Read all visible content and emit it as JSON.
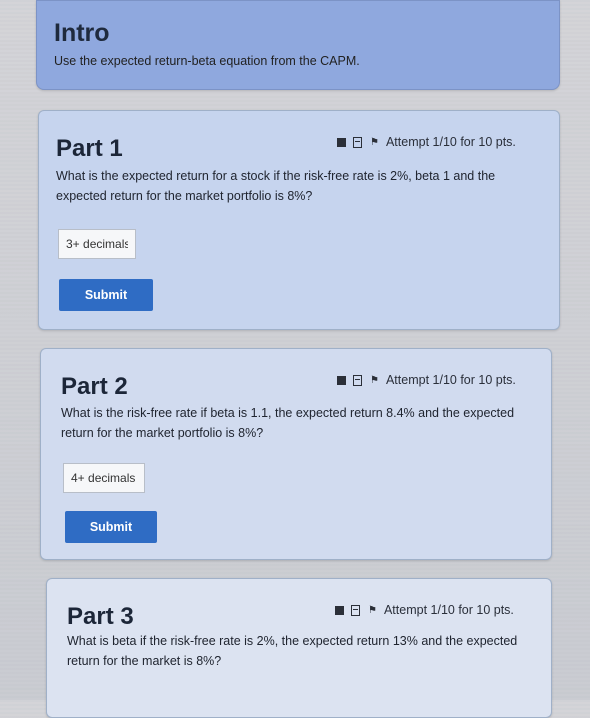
{
  "intro": {
    "title": "Intro",
    "description": "Use the expected return-beta equation from the CAPM."
  },
  "parts": [
    {
      "title": "Part 1",
      "attempt": "Attempt 1/10 for 10 pts.",
      "question": "What is the expected return for a stock if the risk-free rate is 2%, beta 1 and the expected return for the market portfolio is 8%?",
      "placeholder": "3+ decimals",
      "submit_label": "Submit"
    },
    {
      "title": "Part 2",
      "attempt": "Attempt 1/10 for 10 pts.",
      "question": "What is the risk-free rate if beta is 1.1, the expected return 8.4% and the expected return for the market portfolio is 8%?",
      "placeholder": "4+ decimals",
      "submit_label": "Submit"
    },
    {
      "title": "Part 3",
      "attempt": "Attempt 1/10 for 10 pts.",
      "question": "What is beta if the risk-free rate is 2%, the expected return 13% and the expected return for the market is 8%?"
    }
  ]
}
